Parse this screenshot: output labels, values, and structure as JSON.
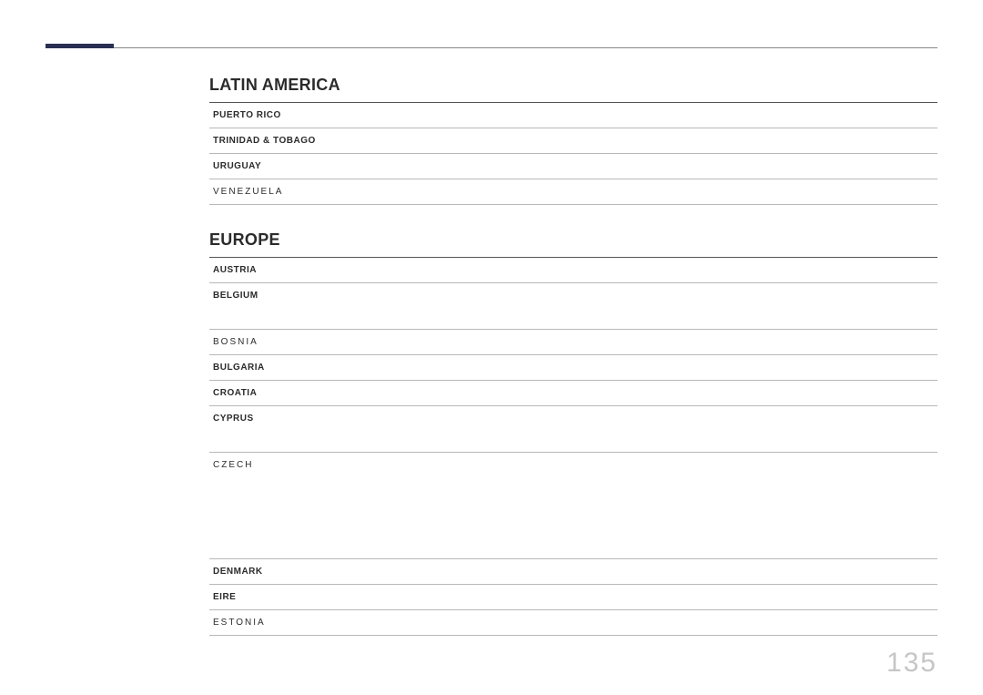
{
  "page_number": "135",
  "sections": [
    {
      "title": "LATIN AMERICA",
      "rows": [
        {
          "country": "PUERTO RICO",
          "col2": "",
          "col3": "",
          "height": ""
        },
        {
          "country": "TRINIDAD & TOBAGO",
          "col2": "",
          "col3": "",
          "height": ""
        },
        {
          "country": "URUGUAY",
          "col2": "",
          "col3": "",
          "height": ""
        },
        {
          "country": "VENEZUELA",
          "col2": "",
          "col3": "",
          "height": "",
          "light": true
        }
      ]
    },
    {
      "title": "EUROPE",
      "rows": [
        {
          "country": "AUSTRIA",
          "col2": "",
          "col3": "",
          "height": ""
        },
        {
          "country": "BELGIUM",
          "col2": "",
          "col3": "",
          "height": "tall"
        },
        {
          "country": "BOSNIA",
          "col2": "",
          "col3": "",
          "height": "",
          "light": true
        },
        {
          "country": "BULGARIA",
          "col2": "",
          "col3": "",
          "height": ""
        },
        {
          "country": "CROATIA",
          "col2": "",
          "col3": "",
          "height": ""
        },
        {
          "country": "CYPRUS",
          "col2": "",
          "col3": "",
          "height": "tall"
        },
        {
          "country": "CZECH",
          "col2": "",
          "col3": "",
          "height": "taller",
          "light": true
        },
        {
          "country": "DENMARK",
          "col2": "",
          "col3": "",
          "height": ""
        },
        {
          "country": "EIRE",
          "col2": "",
          "col3": "",
          "height": ""
        },
        {
          "country": "ESTONIA",
          "col2": "",
          "col3": "",
          "height": "",
          "light": true
        }
      ]
    }
  ]
}
